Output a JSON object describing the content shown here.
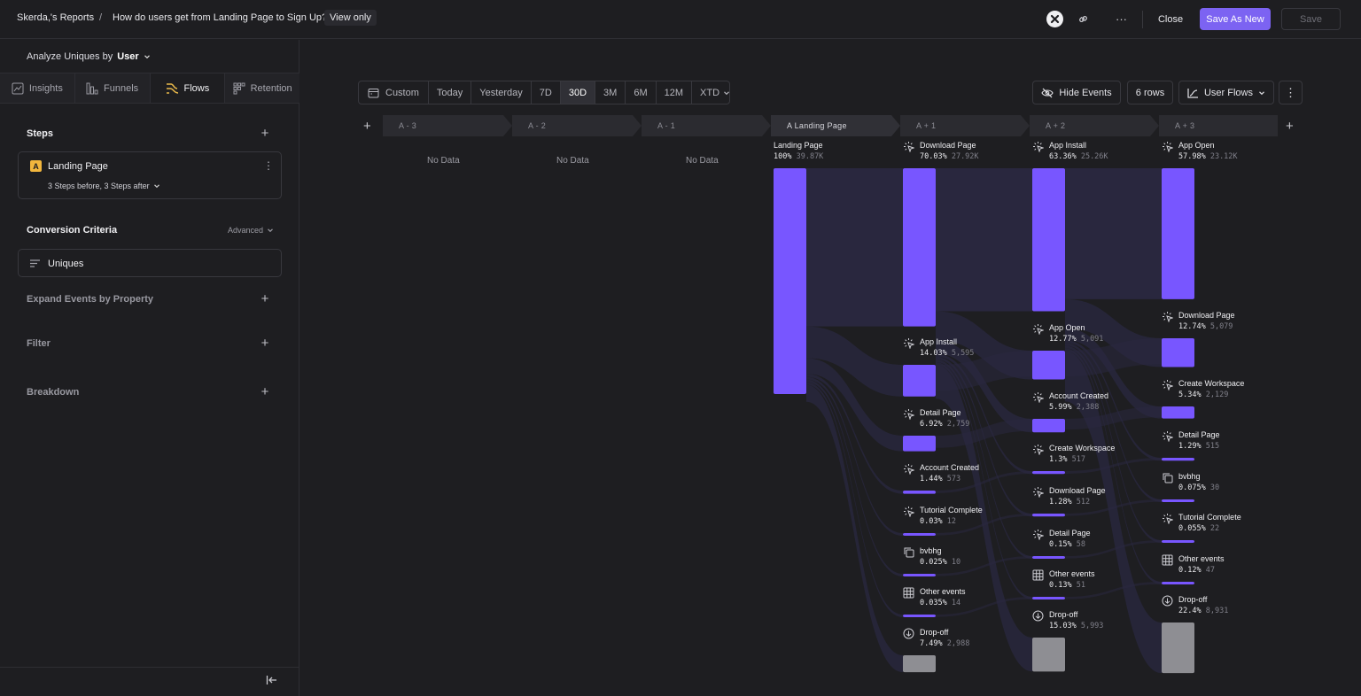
{
  "topbar": {
    "breadcrumb_root": "Skerda,'s Reports",
    "separator": "/",
    "report_title": "How do users get from Landing Page to Sign Up?",
    "view_mode": "View only",
    "close_label": "Close",
    "save_as_new_label": "Save As New",
    "save_label": "Save",
    "more_label": "···"
  },
  "sidebar": {
    "analyze_prefix": "Analyze Uniques by",
    "analyze_value": "User",
    "tabs": [
      {
        "label": "Insights",
        "icon": "insights-icon"
      },
      {
        "label": "Funnels",
        "icon": "funnels-icon"
      },
      {
        "label": "Flows",
        "icon": "flows-icon",
        "active": true
      },
      {
        "label": "Retention",
        "icon": "retention-icon"
      }
    ],
    "steps_title": "Steps",
    "step": {
      "badge": "A",
      "name": "Landing Page",
      "detail": "3 Steps before, 3 Steps after"
    },
    "conversion_title": "Conversion Criteria",
    "advanced_label": "Advanced",
    "uniques_label": "Uniques",
    "expand_label": "Expand Events by Property",
    "filter_label": "Filter",
    "breakdown_label": "Breakdown"
  },
  "toolbar": {
    "date_ranges": [
      "Custom",
      "Today",
      "Yesterday",
      "7D",
      "30D",
      "3M",
      "6M",
      "12M",
      "XTD"
    ],
    "selected": "30D",
    "hide_events_label": "Hide Events",
    "rows_label": "6 rows",
    "view_label": "User Flows"
  },
  "columns": [
    {
      "label": "A - 3",
      "no_data": "No Data"
    },
    {
      "label": "A - 2",
      "no_data": "No Data"
    },
    {
      "label": "A - 1",
      "no_data": "No Data"
    },
    {
      "label": "A  Landing Page"
    },
    {
      "label": "A + 1"
    },
    {
      "label": "A + 2"
    },
    {
      "label": "A + 3"
    }
  ],
  "colors": {
    "accent": "#7856ff",
    "dropoff": "#8e8e93",
    "flow": "#2a2840"
  },
  "chart_data": {
    "type": "sankey",
    "steps": [
      {
        "column": "A",
        "nodes": [
          {
            "name": "Landing Page",
            "pct": "100%",
            "count": "39.87K",
            "value": 39870
          }
        ]
      },
      {
        "column": "A + 1",
        "nodes": [
          {
            "name": "Download Page",
            "pct": "70.03%",
            "count": "27.92K",
            "value": 27920,
            "icon": "event-icon"
          },
          {
            "name": "App Install",
            "pct": "14.03%",
            "count": "5,595",
            "value": 5595,
            "icon": "event-icon"
          },
          {
            "name": "Detail Page",
            "pct": "6.92%",
            "count": "2,759",
            "value": 2759,
            "icon": "event-icon"
          },
          {
            "name": "Account Created",
            "pct": "1.44%",
            "count": "573",
            "value": 573,
            "icon": "event-icon"
          },
          {
            "name": "Tutorial Complete",
            "pct": "0.03%",
            "count": "12",
            "value": 12,
            "icon": "event-icon"
          },
          {
            "name": "bvbhg",
            "pct": "0.025%",
            "count": "10",
            "value": 10,
            "icon": "copy-icon"
          },
          {
            "name": "Other events",
            "pct": "0.035%",
            "count": "14",
            "value": 14,
            "icon": "grid-icon"
          },
          {
            "name": "Drop-off",
            "pct": "7.49%",
            "count": "2,988",
            "value": 2988,
            "icon": "dropoff-icon",
            "dropoff": true
          }
        ]
      },
      {
        "column": "A + 2",
        "nodes": [
          {
            "name": "App Install",
            "pct": "63.36%",
            "count": "25.26K",
            "value": 25260,
            "icon": "event-icon"
          },
          {
            "name": "App Open",
            "pct": "12.77%",
            "count": "5,091",
            "value": 5091,
            "icon": "event-icon"
          },
          {
            "name": "Account Created",
            "pct": "5.99%",
            "count": "2,388",
            "value": 2388,
            "icon": "event-icon"
          },
          {
            "name": "Create Workspace",
            "pct": "1.3%",
            "count": "517",
            "value": 517,
            "icon": "event-icon"
          },
          {
            "name": "Download Page",
            "pct": "1.28%",
            "count": "512",
            "value": 512,
            "icon": "event-icon"
          },
          {
            "name": "Detail Page",
            "pct": "0.15%",
            "count": "58",
            "value": 58,
            "icon": "event-icon"
          },
          {
            "name": "Other events",
            "pct": "0.13%",
            "count": "51",
            "value": 51,
            "icon": "grid-icon"
          },
          {
            "name": "Drop-off",
            "pct": "15.03%",
            "count": "5,993",
            "value": 5993,
            "icon": "dropoff-icon",
            "dropoff": true
          }
        ]
      },
      {
        "column": "A + 3",
        "nodes": [
          {
            "name": "App Open",
            "pct": "57.98%",
            "count": "23.12K",
            "value": 23120,
            "icon": "event-icon"
          },
          {
            "name": "Download Page",
            "pct": "12.74%",
            "count": "5,079",
            "value": 5079,
            "icon": "event-icon"
          },
          {
            "name": "Create Workspace",
            "pct": "5.34%",
            "count": "2,129",
            "value": 2129,
            "icon": "event-icon"
          },
          {
            "name": "Detail Page",
            "pct": "1.29%",
            "count": "515",
            "value": 515,
            "icon": "event-icon"
          },
          {
            "name": "bvbhg",
            "pct": "0.075%",
            "count": "30",
            "value": 30,
            "icon": "copy-icon"
          },
          {
            "name": "Tutorial Complete",
            "pct": "0.055%",
            "count": "22",
            "value": 22,
            "icon": "event-icon"
          },
          {
            "name": "Other events",
            "pct": "0.12%",
            "count": "47",
            "value": 47,
            "icon": "grid-icon"
          },
          {
            "name": "Drop-off",
            "pct": "22.4%",
            "count": "8,931",
            "value": 8931,
            "icon": "dropoff-icon",
            "dropoff": true
          }
        ]
      }
    ]
  }
}
